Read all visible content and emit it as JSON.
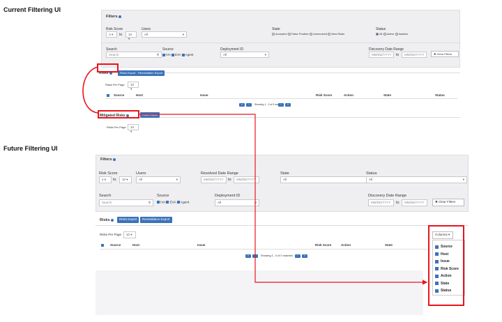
{
  "labels": {
    "current": "Current Filtering UI",
    "future": "Future Filtering UI"
  },
  "current": {
    "filters_title": "Filters",
    "risk_score_label": "Risk Score",
    "risk_min": "A",
    "to": "to",
    "risk_max": "10",
    "users_label": "Users",
    "users_value": "All",
    "state_label": "State",
    "state_options": [
      "Accepted",
      "False Positive",
      "Unresolved",
      "New Risks"
    ],
    "status_label": "Status",
    "status_options": [
      "All",
      "Active",
      "Inactive"
    ],
    "search_label": "Search",
    "search_placeholder": "Search",
    "source_label": "Source",
    "source_options": [
      "IVA",
      "EVA",
      "Agent"
    ],
    "deployment_label": "Deployment ID",
    "deployment_value": "All",
    "discovery_label": "Discovery Date Range",
    "date_placeholder": "MM/DD/YYYY",
    "clear_filters": "Clear Filters",
    "risks_tab": "Risks",
    "risks_export": "Risks Export",
    "remediation_export": "Remediation Export",
    "risks_per_page_label": "Risks Per Page",
    "risks_per_page_value": "10",
    "columns": [
      "Source",
      "Host",
      "Issue",
      "Risk Score",
      "Action",
      "State",
      "Status"
    ],
    "showing": "Showing 1 - 0 of 0 matches",
    "mitigated_tab": "Mitigated Risks",
    "mitigated_per_page_label": "Risks Per Page",
    "mitigated_per_page_value": "10"
  },
  "future": {
    "filters_title": "Filters",
    "risk_score_label": "Risk Score",
    "risk_min": "4",
    "to": "to",
    "risk_max": "10",
    "users_label": "Users",
    "users_value": "All",
    "resolved_label": "Resolved Date Range",
    "date_placeholder": "MM/DD/YYYY",
    "state_label": "State",
    "state_value": "All",
    "status_label": "Status",
    "status_value": "All",
    "search_label": "Search",
    "search_placeholder": "Search",
    "source_label": "Source",
    "source_options": [
      "IVA",
      "EVA",
      "Agent"
    ],
    "deployment_label": "Deployment ID",
    "deployment_value": "All",
    "discovery_label": "Discovery Date Range",
    "clear_filters": "Clear Filters",
    "risks_tab": "Risks",
    "risks_export": "Risks Export",
    "remediation_export": "Remediation Export",
    "risks_per_page_label": "Risks Per Page",
    "risks_per_page_value": "10",
    "columns_button": "Columns",
    "columns": [
      "Source",
      "Host",
      "Issue",
      "Risk Score",
      "Action",
      "State"
    ],
    "showing": "Showing 1 - 0 of 0 matches",
    "column_menu": [
      "Source",
      "Host",
      "Issue",
      "Risk Score",
      "Action",
      "State",
      "Status"
    ]
  },
  "colors": {
    "accent": "#3b73b9",
    "highlight": "#e8141b",
    "panel": "#efeff2"
  }
}
